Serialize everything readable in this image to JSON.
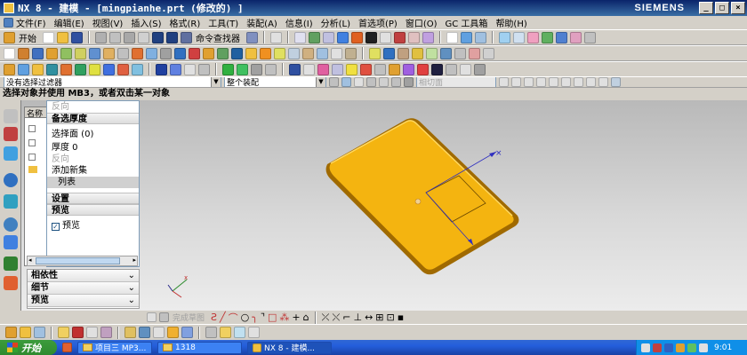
{
  "window": {
    "title": "NX 8 - 建模 - [mingpianhe.prt  (修改的)  ]",
    "brand": "SIEMENS"
  },
  "menu": [
    "文件(F)",
    "编辑(E)",
    "视图(V)",
    "插入(S)",
    "格式(R)",
    "工具(T)",
    "装配(A)",
    "信息(I)",
    "分析(L)",
    "首选项(P)",
    "窗口(O)",
    "GC 工具箱",
    "帮助(H)"
  ],
  "toolbar": {
    "start_label": "开始",
    "command_finder_label": "命令查找器"
  },
  "selection_bar": {
    "filter_value": "没有选择过滤器",
    "assembly_value": "整个装配",
    "snap_placeholder": "相切面"
  },
  "status_message": "选择对象并使用 MB3，或者双击某一对象",
  "nav_panel": {
    "header": "名称"
  },
  "dialog": {
    "reverse_top": "反向",
    "alt_thickness_header": "备选厚度",
    "select_face": "选择面 (0)",
    "thickness": "厚度 0",
    "reverse_disabled": "反向",
    "add_new_set": "添加新集",
    "list_label": "列表",
    "settings_header": "设置",
    "preview_header": "预览",
    "preview_checkbox": "预览"
  },
  "lower_panel": {
    "dependencies": "相依性",
    "details": "细节",
    "preview": "预览"
  },
  "sketch_toolbar": {
    "finish_sketch": "完成草图"
  },
  "taskbar": {
    "start_label": "开始",
    "tasks": [
      "项目三 MP3...",
      "1318",
      "NX 8 - 建模..."
    ],
    "clock": "9:01"
  },
  "colors": {
    "part_fill": "#f4b410",
    "part_edge": "#a06a00",
    "vector_blue": "#3030c0",
    "taskbar_blue": "#245edb"
  }
}
